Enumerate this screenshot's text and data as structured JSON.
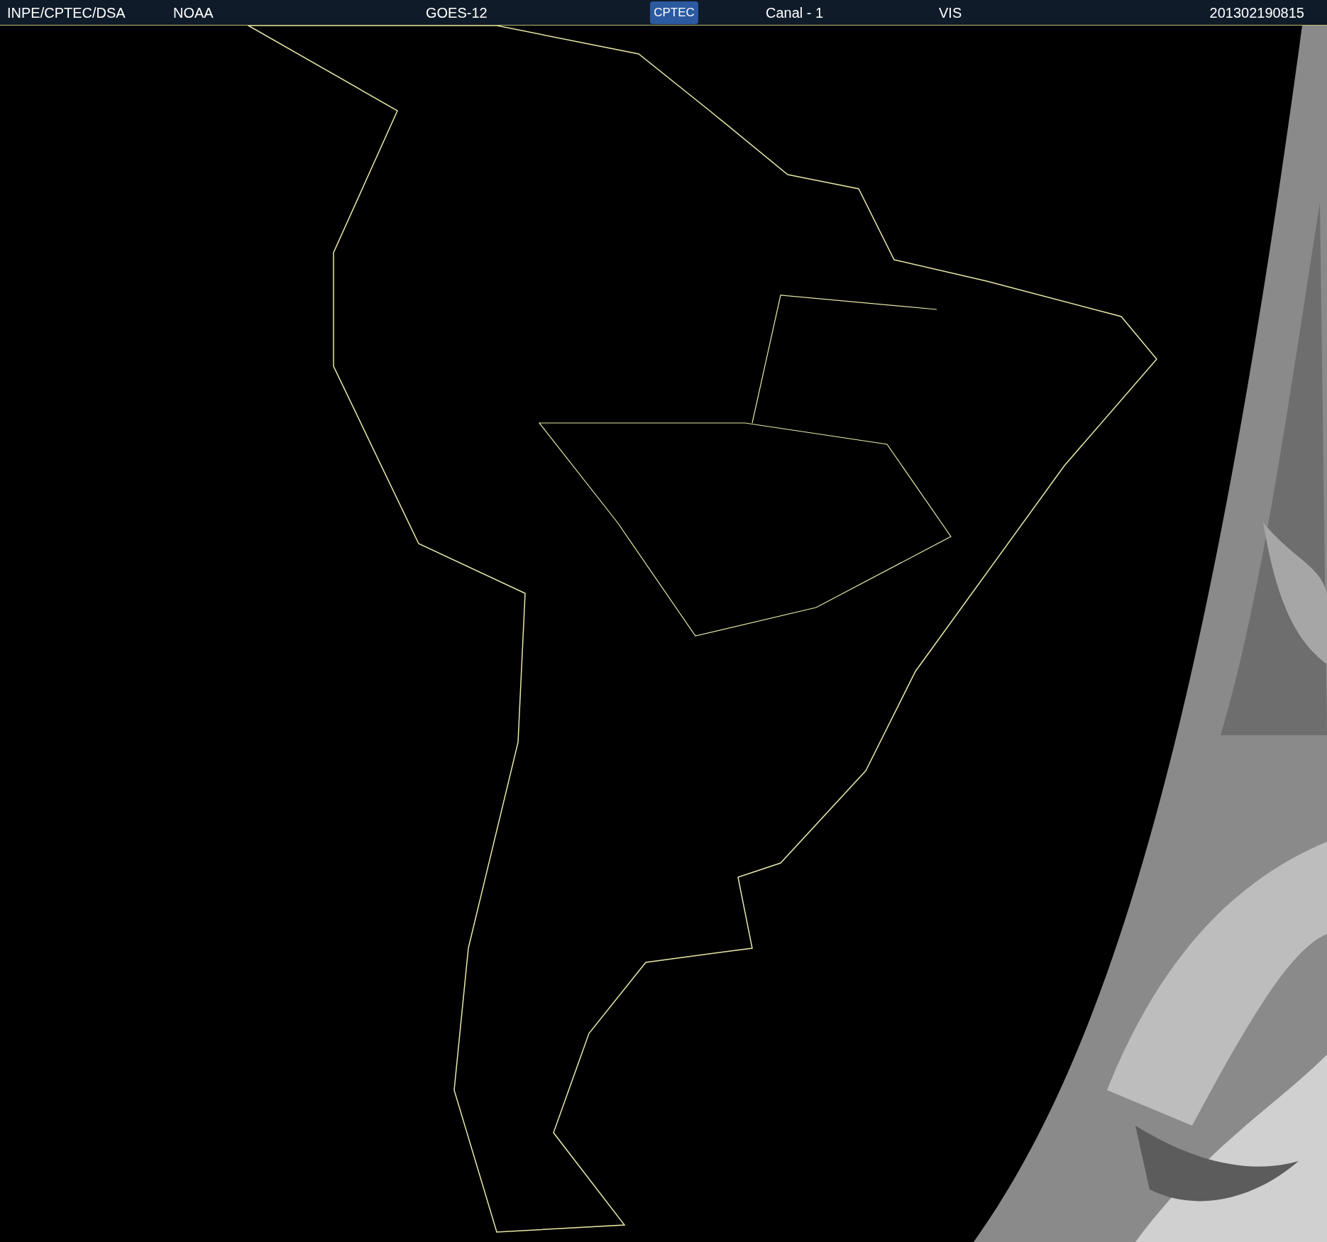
{
  "header": {
    "source": "INPE/CPTEC/DSA",
    "agency": "NOAA",
    "satellite": "GOES-12",
    "logo": "CPTEC",
    "channel": "Canal - 1",
    "band": "VIS",
    "timestamp": "201302190815"
  }
}
